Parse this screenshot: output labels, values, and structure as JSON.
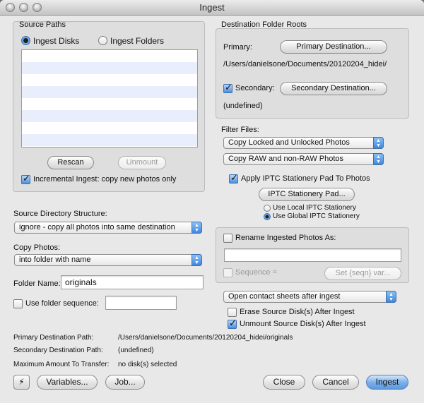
{
  "window": {
    "title": "Ingest"
  },
  "source_paths": {
    "title": "Source Paths",
    "radio_ingest_disks": "Ingest Disks",
    "radio_ingest_folders": "Ingest Folders",
    "rescan": "Rescan",
    "unmount": "Unmount",
    "incremental": "Incremental Ingest: copy new photos only"
  },
  "destination": {
    "title": "Destination Folder Roots",
    "primary_label": "Primary:",
    "primary_button": "Primary Destination...",
    "primary_path": "/Users/danielsone/Documents/20120204_hidei/",
    "secondary_label": "Secondary:",
    "secondary_button": "Secondary Destination...",
    "secondary_value": "(undefined)"
  },
  "filter": {
    "title": "Filter Files:",
    "locked_option": "Copy Locked and Unlocked Photos",
    "raw_option": "Copy RAW and non-RAW Photos",
    "apply_iptc": "Apply IPTC Stationery Pad To Photos",
    "iptc_button": "IPTC Stationery Pad...",
    "use_local": "Use Local IPTC Stationery",
    "use_global": "Use Global IPTC Stationery"
  },
  "structure": {
    "label": "Source Directory Structure:",
    "value": "ignore - copy all photos into same destination"
  },
  "copy_photos": {
    "label": "Copy Photos:",
    "value": "into folder with name"
  },
  "folder": {
    "name_label": "Folder Name:",
    "name_value": "originals",
    "sequence_label": "Use folder sequence:",
    "sequence_value": ""
  },
  "rename": {
    "label": "Rename Ingested Photos As:",
    "value": "",
    "sequence_label": "Sequence =",
    "sequence_button": "Set {seqn} var..."
  },
  "after": {
    "contact_sheets": "Open contact sheets after ingest",
    "erase": "Erase Source Disk(s) After Ingest",
    "unmount": "Unmount Source Disk(s) After Ingest"
  },
  "info": {
    "primary_label": "Primary Destination Path:",
    "primary_value": "/Users/danielsone/Documents/20120204_hidei/originals",
    "secondary_label": "Secondary Destination Path:",
    "secondary_value": "(undefined)",
    "max_label": "Maximum Amount To Transfer:",
    "max_value": "no disk(s) selected"
  },
  "footer": {
    "bolt_icon": "⚡",
    "variables": "Variables...",
    "job": "Job...",
    "close": "Close",
    "cancel": "Cancel",
    "ingest": "Ingest"
  }
}
